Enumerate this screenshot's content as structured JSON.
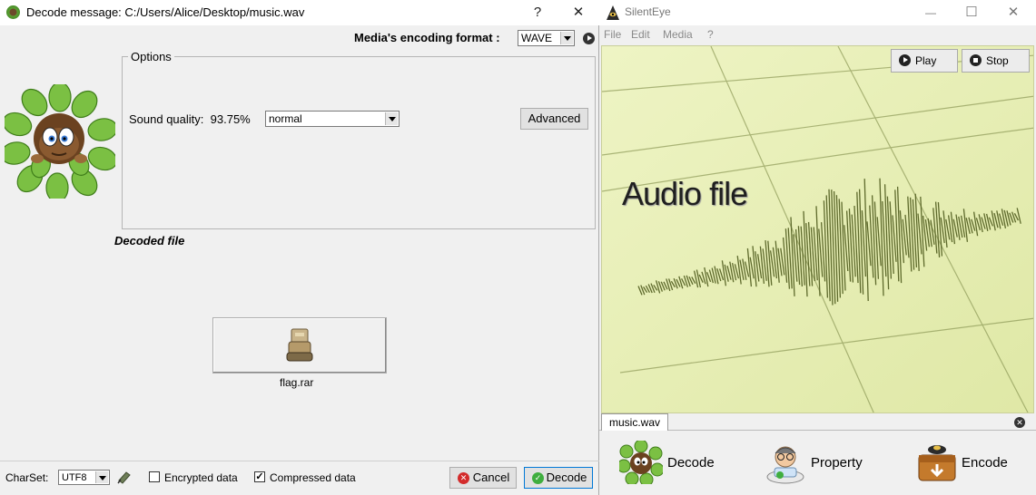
{
  "decode_dialog": {
    "title": "Decode message: C:/Users/Alice/Desktop/music.wav",
    "help_symbol": "?",
    "close_symbol": "✕",
    "encoding_format_label": "Media's encoding format :",
    "encoding_format_value": "WAVE",
    "options_title": "Options",
    "sound_quality_label": "Sound quality:",
    "sound_quality_value": "93.75%",
    "sound_quality_select": "normal",
    "advanced_label": "Advanced",
    "decoded_file_label": "Decoded file",
    "file_name": "flag.rar",
    "charset_label": "CharSet:",
    "charset_value": "UTF8",
    "encrypted_label": "Encrypted data",
    "encrypted_checked": false,
    "compressed_label": "Compressed data",
    "compressed_checked": true,
    "cancel_label": "Cancel",
    "decode_label": "Decode"
  },
  "silenteye": {
    "title": "SilentEye",
    "minimize_symbol": "—",
    "maximize_symbol": "☐",
    "close_symbol": "✕",
    "menu": [
      "File",
      "Edit",
      "Media",
      "?"
    ],
    "play_label": "Play",
    "stop_label": "Stop",
    "media_title": "Audio file",
    "tab_label": "music.wav",
    "actions": {
      "decode": "Decode",
      "property": "Property",
      "encode": "Encode"
    }
  },
  "colors": {
    "waveform_bg": "#e8efb8",
    "waveform_ink": "#6f7a3a",
    "dialog_bg": "#f0f0f0"
  }
}
